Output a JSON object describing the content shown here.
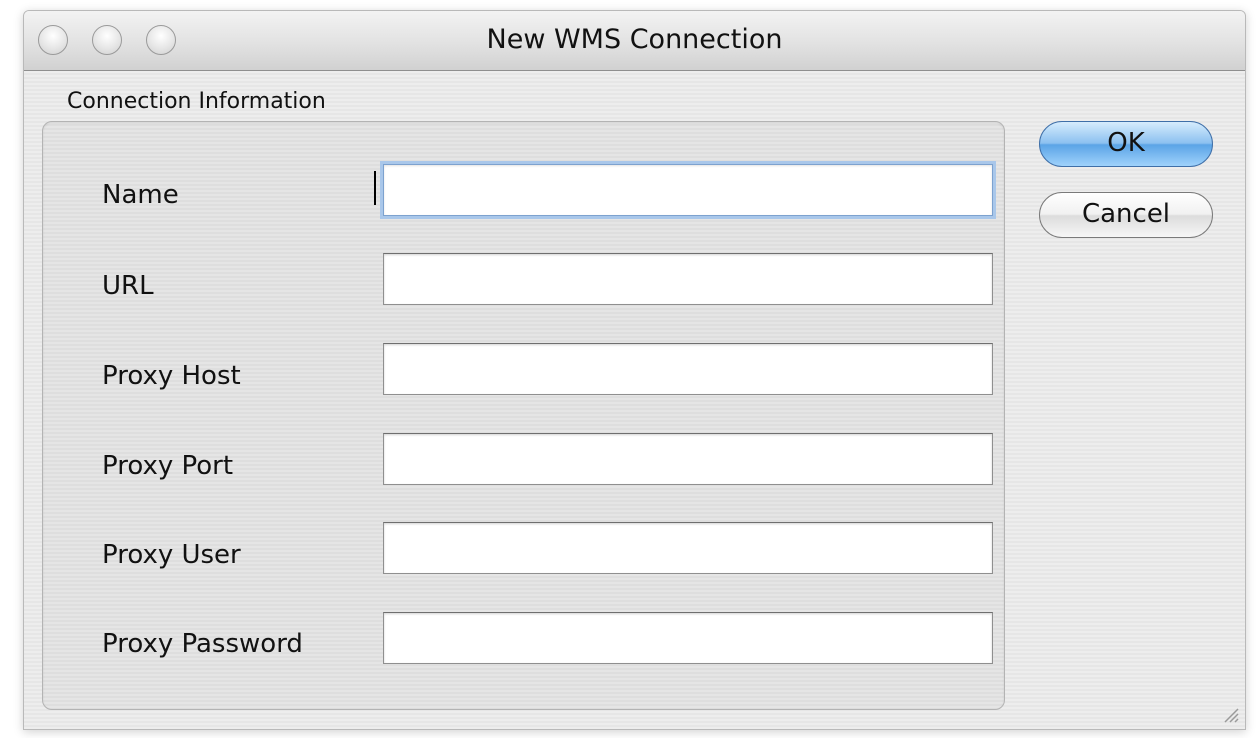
{
  "window": {
    "title": "New WMS Connection"
  },
  "section": {
    "label": "Connection Information"
  },
  "fields": [
    {
      "label": "Name",
      "value": ""
    },
    {
      "label": "URL",
      "value": ""
    },
    {
      "label": "Proxy Host",
      "value": ""
    },
    {
      "label": "Proxy Port",
      "value": ""
    },
    {
      "label": "Proxy User",
      "value": ""
    },
    {
      "label": "Proxy Password",
      "value": ""
    }
  ],
  "buttons": {
    "ok_label": "OK",
    "cancel_label": "Cancel"
  },
  "colors": {
    "ok_accent": "#5ba4e6",
    "focus_ring": "#a9c7ea"
  }
}
